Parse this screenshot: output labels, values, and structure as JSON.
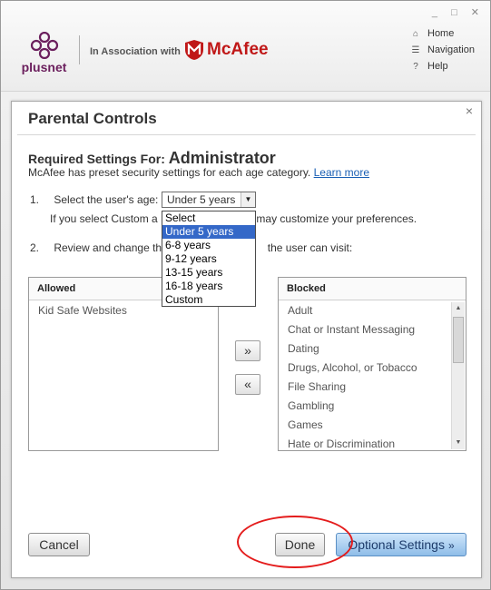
{
  "window": {
    "controls": "_ □ ✕"
  },
  "branding": {
    "plusnet": "plusnet",
    "association": "In Association with",
    "mcafee": "McAfee"
  },
  "topnav": [
    {
      "icon": "home-icon",
      "label": "Home"
    },
    {
      "icon": "navigation-icon",
      "label": "Navigation"
    },
    {
      "icon": "help-icon",
      "label": "Help"
    }
  ],
  "dialog": {
    "title": "Parental Controls",
    "close": "×",
    "required_prefix": "Required Settings For:",
    "user": "Administrator",
    "preset_text": "McAfee has preset security settings for each age category.",
    "learn_more": "Learn more",
    "step1_num": "1.",
    "step1_label": "Select the user's age:",
    "hint_left": "If you select Custom a",
    "hint_right": "may customize your preferences.",
    "step2_num": "2.",
    "step2_left": "Review and change th",
    "step2_right": "the user can visit:",
    "age_select": {
      "value": "Under 5 years",
      "options": [
        "Select",
        "Under 5 years",
        "6-8 years",
        "9-12 years",
        "13-15 years",
        "16-18 years",
        "Custom"
      ],
      "highlighted_index": 1
    },
    "allowed": {
      "header": "Allowed",
      "items": [
        "Kid Safe Websites"
      ]
    },
    "blocked": {
      "header": "Blocked",
      "items": [
        "Adult",
        "Chat or Instant Messaging",
        "Dating",
        "Drugs, Alcohol, or Tobacco",
        "File Sharing",
        "Gambling",
        "Games",
        "Hate or Discrimination"
      ]
    },
    "move_right": "»",
    "move_left": "«",
    "buttons": {
      "cancel": "Cancel",
      "done": "Done",
      "optional": "Optional Settings",
      "optional_chevron": "»"
    }
  },
  "colors": {
    "accent": "#3468c8",
    "mcafee_red": "#c01818",
    "plusnet_purple": "#6b1f5d",
    "annotation_red": "#e41c1c"
  }
}
